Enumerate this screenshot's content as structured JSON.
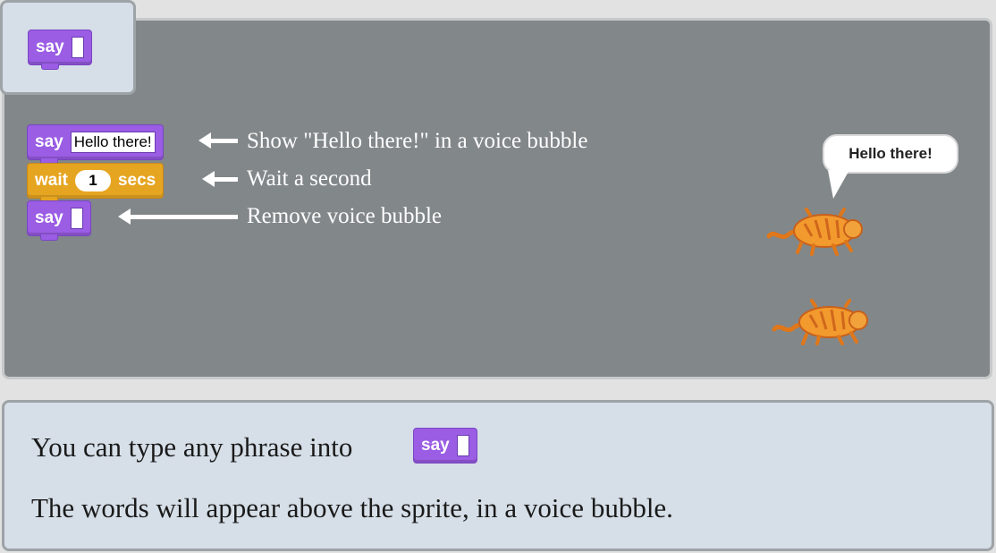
{
  "palette_card": {
    "say_block": {
      "keyword": "say",
      "input": ""
    }
  },
  "script": {
    "say_hello": {
      "keyword": "say",
      "input": "Hello there!"
    },
    "wait": {
      "keyword": "wait",
      "input": "1",
      "unit": "secs"
    },
    "say_empty": {
      "keyword": "say",
      "input": ""
    }
  },
  "annotations": {
    "say_hello": "Show \"Hello there!\" in a voice bubble",
    "wait": "Wait a second",
    "say_empty": "Remove voice bubble"
  },
  "stage": {
    "speech_bubble": "Hello there!"
  },
  "tip": {
    "line1_text": "You can type any phrase into",
    "inline_block": {
      "keyword": "say",
      "input": ""
    },
    "line2_text": "The words will appear above the sprite, in a voice bubble."
  },
  "colors": {
    "looks": "#9a5de4",
    "control": "#e6a521",
    "stage": "#828789",
    "panel": "#d6dfe8"
  }
}
